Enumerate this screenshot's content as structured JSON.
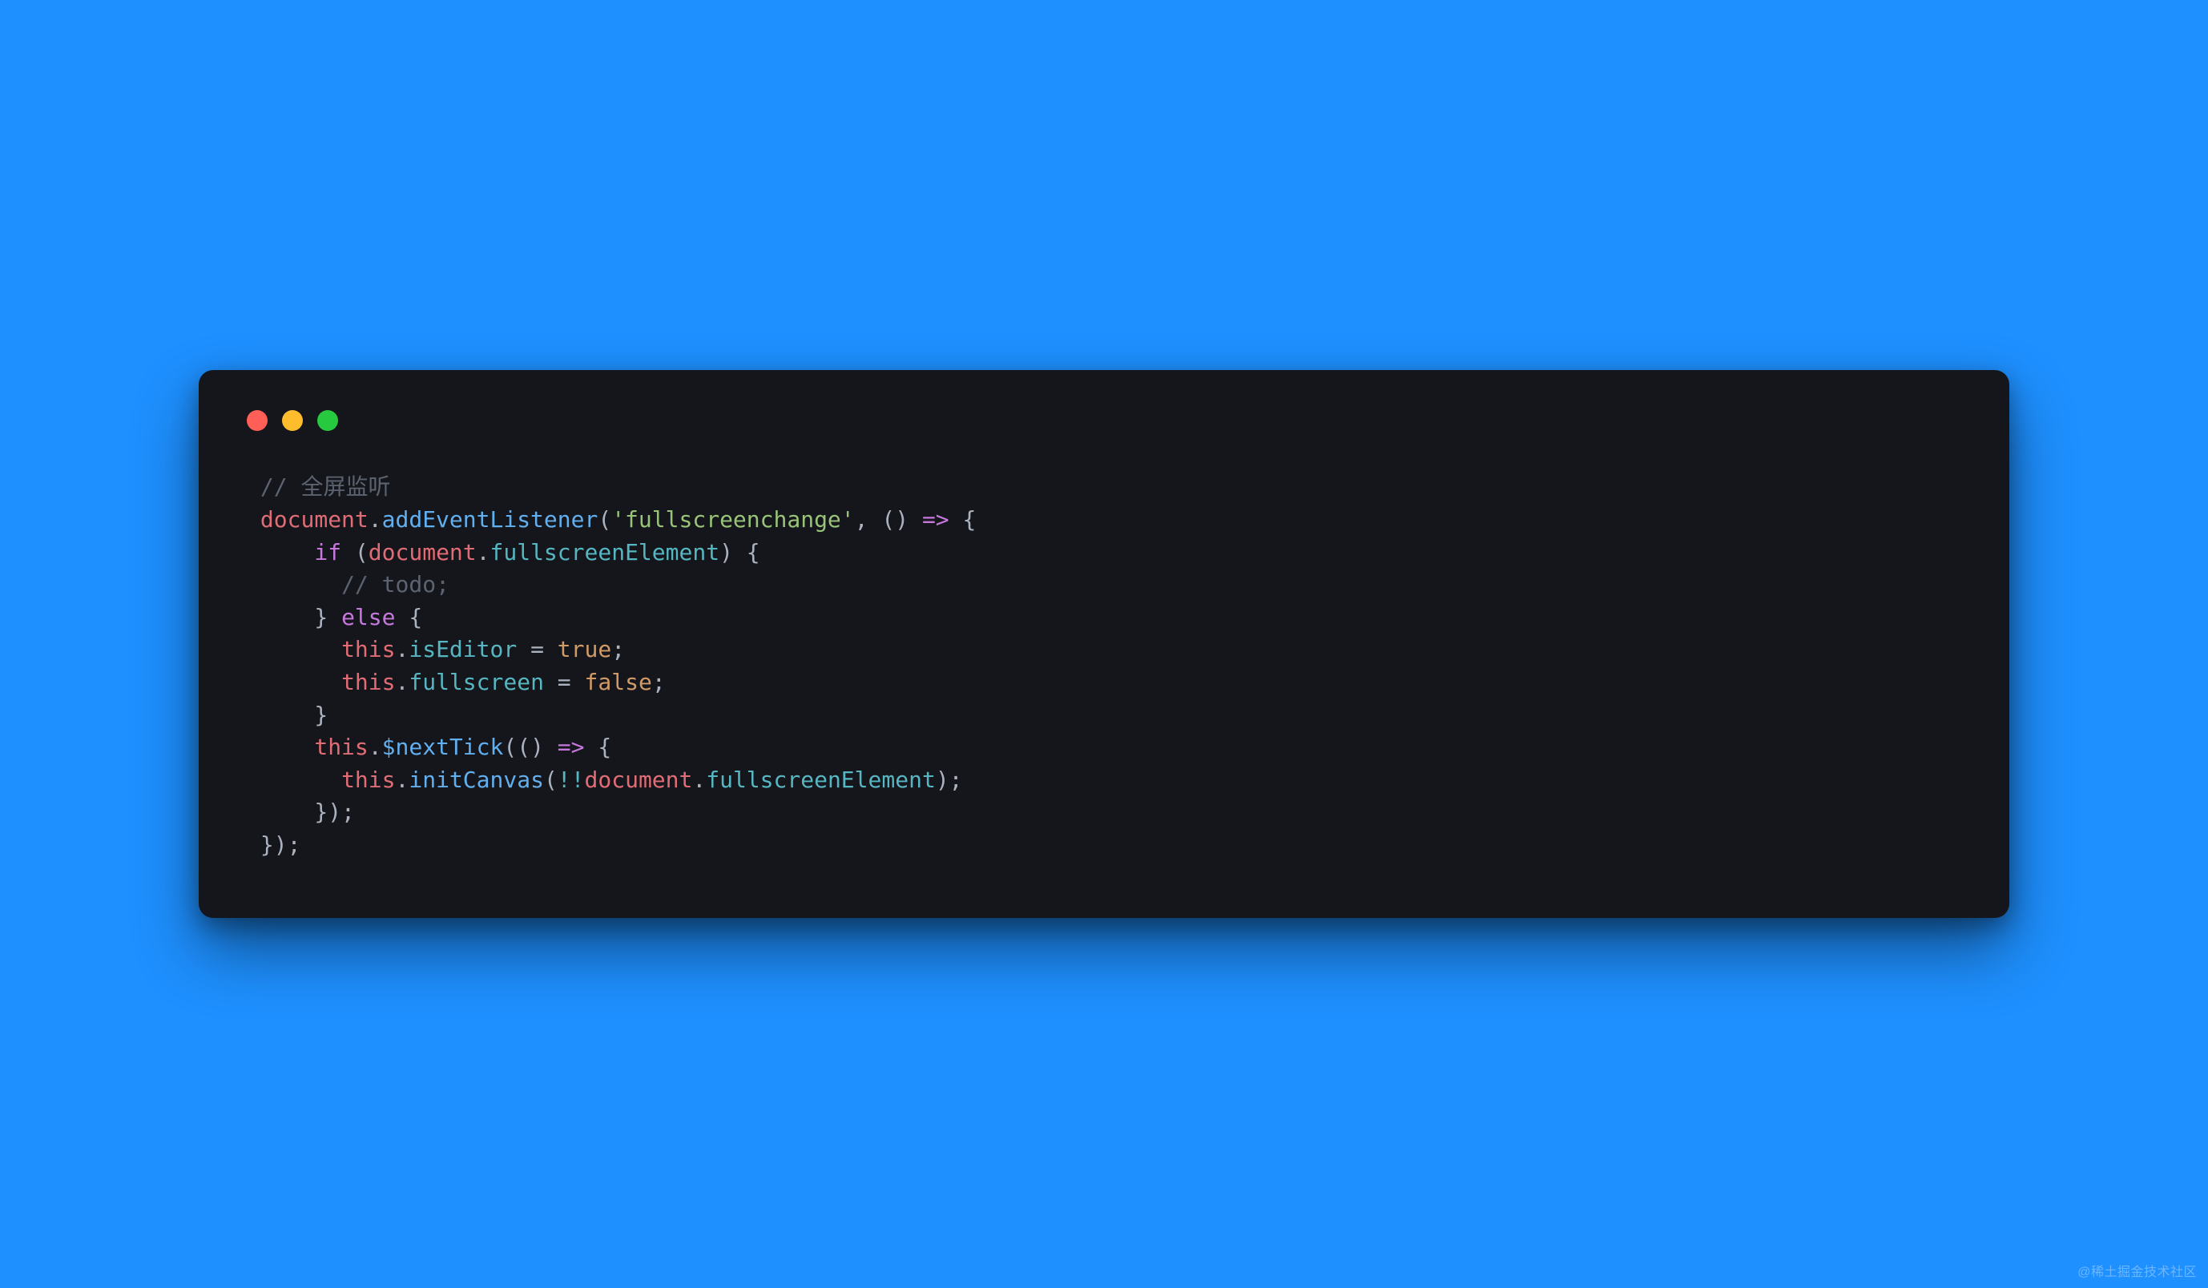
{
  "window": {
    "traffic_lights": {
      "red": "#ff5f56",
      "yellow": "#ffbd2e",
      "green": "#27c93f"
    }
  },
  "code": {
    "tokens": [
      [
        {
          "t": " ",
          "c": "p"
        },
        {
          "t": "// 全屏监听",
          "c": "c"
        }
      ],
      [
        {
          "t": " ",
          "c": "p"
        },
        {
          "t": "document",
          "c": "v"
        },
        {
          "t": ".",
          "c": "p"
        },
        {
          "t": "addEventListener",
          "c": "fn"
        },
        {
          "t": "(",
          "c": "p"
        },
        {
          "t": "'fullscreenchange'",
          "c": "s"
        },
        {
          "t": ", () ",
          "c": "p"
        },
        {
          "t": "=>",
          "c": "k"
        },
        {
          "t": " {",
          "c": "p"
        }
      ],
      [
        {
          "t": "     ",
          "c": "p"
        },
        {
          "t": "if",
          "c": "k"
        },
        {
          "t": " (",
          "c": "p"
        },
        {
          "t": "document",
          "c": "v"
        },
        {
          "t": ".",
          "c": "p"
        },
        {
          "t": "fullscreenElement",
          "c": "pr"
        },
        {
          "t": ") {",
          "c": "p"
        }
      ],
      [
        {
          "t": "       ",
          "c": "p"
        },
        {
          "t": "// todo;",
          "c": "c"
        }
      ],
      [
        {
          "t": "     } ",
          "c": "p"
        },
        {
          "t": "else",
          "c": "k"
        },
        {
          "t": " {",
          "c": "p"
        }
      ],
      [
        {
          "t": "       ",
          "c": "p"
        },
        {
          "t": "this",
          "c": "v"
        },
        {
          "t": ".",
          "c": "p"
        },
        {
          "t": "isEditor",
          "c": "pr"
        },
        {
          "t": " = ",
          "c": "p"
        },
        {
          "t": "true",
          "c": "b"
        },
        {
          "t": ";",
          "c": "p"
        }
      ],
      [
        {
          "t": "       ",
          "c": "p"
        },
        {
          "t": "this",
          "c": "v"
        },
        {
          "t": ".",
          "c": "p"
        },
        {
          "t": "fullscreen",
          "c": "pr"
        },
        {
          "t": " = ",
          "c": "p"
        },
        {
          "t": "false",
          "c": "b"
        },
        {
          "t": ";",
          "c": "p"
        }
      ],
      [
        {
          "t": "     }",
          "c": "p"
        }
      ],
      [
        {
          "t": "     ",
          "c": "p"
        },
        {
          "t": "this",
          "c": "v"
        },
        {
          "t": ".",
          "c": "p"
        },
        {
          "t": "$nextTick",
          "c": "fn"
        },
        {
          "t": "(() ",
          "c": "p"
        },
        {
          "t": "=>",
          "c": "k"
        },
        {
          "t": " {",
          "c": "p"
        }
      ],
      [
        {
          "t": "       ",
          "c": "p"
        },
        {
          "t": "this",
          "c": "v"
        },
        {
          "t": ".",
          "c": "p"
        },
        {
          "t": "initCanvas",
          "c": "fn"
        },
        {
          "t": "(",
          "c": "p"
        },
        {
          "t": "!!",
          "c": "op"
        },
        {
          "t": "document",
          "c": "v"
        },
        {
          "t": ".",
          "c": "p"
        },
        {
          "t": "fullscreenElement",
          "c": "pr"
        },
        {
          "t": ");",
          "c": "p"
        }
      ],
      [
        {
          "t": "     });",
          "c": "p"
        }
      ],
      [
        {
          "t": " });",
          "c": "p"
        }
      ]
    ]
  },
  "watermark": "@稀土掘金技术社区"
}
